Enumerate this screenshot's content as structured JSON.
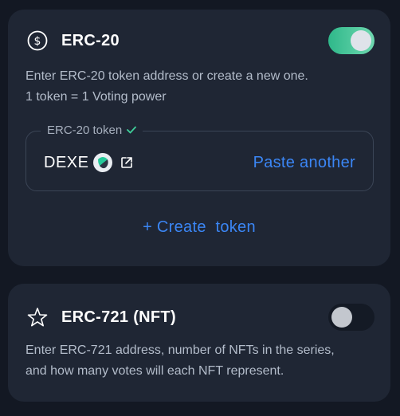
{
  "erc20": {
    "title": "ERC-20",
    "icon": "dollar-circle-icon",
    "enabled": true,
    "description_line1": "Enter ERC-20 token address or create a new one.",
    "description_line2": "1 token = 1 Voting power",
    "field_label": "ERC-20 token",
    "field_label_icon": "check-icon",
    "token_name": "DEXE",
    "token_logo_icon": "dexe-logo-icon",
    "external_link_icon": "external-link-icon",
    "paste_label": "Paste another",
    "create_label": "+ Create  token"
  },
  "erc721": {
    "title": "ERC-721 (NFT)",
    "icon": "star-icon",
    "enabled": false,
    "description_line1": "Enter ERC-721 address, number of NFTs in the series,",
    "description_line2": "and how many votes will each NFT represent."
  },
  "colors": {
    "background": "#131823",
    "card": "#1f2634",
    "accent": "#3b86f5",
    "toggle_on": "#2fb88a",
    "text_secondary": "#b3bcca"
  }
}
